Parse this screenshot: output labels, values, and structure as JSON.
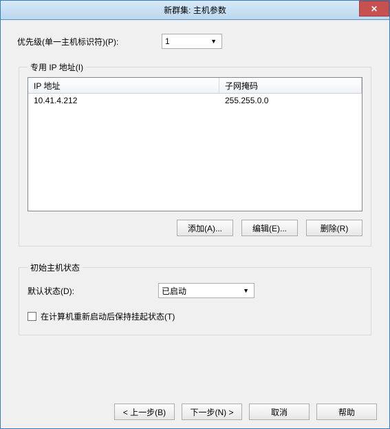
{
  "title": "新群集: 主机参数",
  "priority": {
    "label": "优先级(单一主机标识符)(P):",
    "value": "1"
  },
  "dedicated_ip": {
    "legend": "专用 IP 地址(I)",
    "columns": {
      "ip": "IP 地址",
      "mask": "子网掩码"
    },
    "rows": [
      {
        "ip": "10.41.4.212",
        "mask": "255.255.0.0"
      }
    ],
    "buttons": {
      "add": "添加(A)...",
      "edit": "编辑(E)...",
      "remove": "删除(R)"
    }
  },
  "initial_state": {
    "legend": "初始主机状态",
    "default_label": "默认状态(D):",
    "default_value": "已启动",
    "retain_label": "在计算机重新启动后保持挂起状态(T)",
    "retain_checked": false
  },
  "footer": {
    "back": "< 上一步(B)",
    "next": "下一步(N) >",
    "cancel": "取消",
    "help": "帮助"
  }
}
